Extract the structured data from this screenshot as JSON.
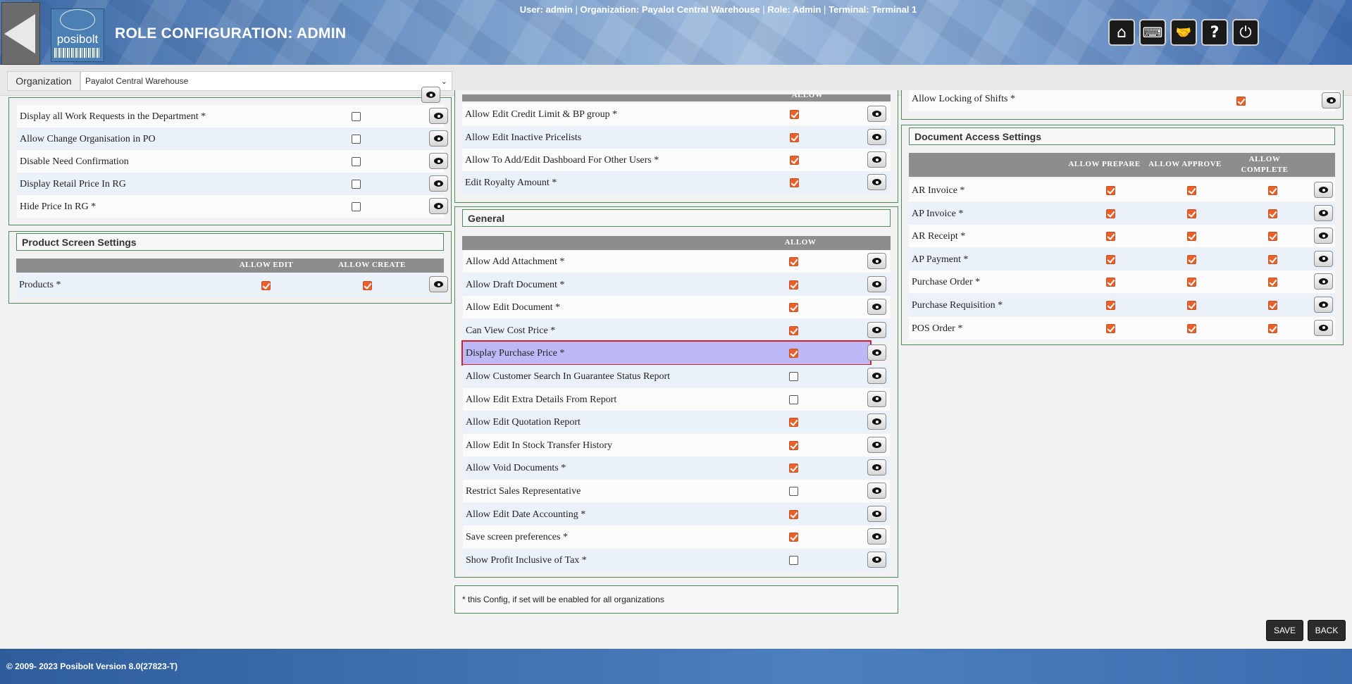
{
  "header": {
    "title": "ROLE CONFIGURATION: ADMIN",
    "logo_text": "posibolt",
    "user_label": "User: admin",
    "org_label": "Organization: Payalot Central Warehouse",
    "role_label": "Role: Admin",
    "terminal_label": "Terminal: Terminal 1",
    "separator": "|",
    "icons": [
      "home-icon",
      "keyboard-icon",
      "handshake-icon",
      "help-icon",
      "power-icon"
    ],
    "icon_glyphs": [
      "⌂",
      "⌨",
      "🤝",
      "?",
      "⏻"
    ]
  },
  "orgbar": {
    "label": "Organization",
    "selected": "Payalot Central Warehouse"
  },
  "left_top_rows": [
    {
      "label": "Display all Work Requests in the Department *",
      "checked": false
    },
    {
      "label": "Allow Change Organisation in PO",
      "checked": false
    },
    {
      "label": "Disable Need Confirmation",
      "checked": false
    },
    {
      "label": "Display Retail Price In RG",
      "checked": false
    },
    {
      "label": "Hide Price In RG *",
      "checked": false
    }
  ],
  "product_screen": {
    "title": "Product Screen Settings",
    "col_edit": "ALLOW EDIT",
    "col_create": "ALLOW CREATE",
    "rows": [
      {
        "label": "Products *",
        "edit": true,
        "create": true
      }
    ]
  },
  "mid_top": {
    "col_allow": "ALLOW",
    "rows": [
      {
        "label": "Allow Edit Credit Limit & BP group *",
        "checked": true
      },
      {
        "label": "Allow Edit Inactive Pricelists",
        "checked": true
      },
      {
        "label": "Allow To Add/Edit Dashboard For Other Users *",
        "checked": true
      },
      {
        "label": "Edit Royalty Amount *",
        "checked": true
      }
    ]
  },
  "general": {
    "title": "General",
    "col_allow": "ALLOW",
    "rows": [
      {
        "label": "Allow Add Attachment *",
        "checked": true
      },
      {
        "label": "Allow Draft Document *",
        "checked": true
      },
      {
        "label": "Allow Edit Document *",
        "checked": true
      },
      {
        "label": "Can View Cost Price *",
        "checked": true
      },
      {
        "label": "Display Purchase Price *",
        "checked": true
      },
      {
        "label": "Allow Customer Search In Guarantee Status Report",
        "checked": false
      },
      {
        "label": "Allow Edit Extra Details From Report",
        "checked": false
      },
      {
        "label": "Allow Edit Quotation Report",
        "checked": true
      },
      {
        "label": "Allow Edit In Stock Transfer History",
        "checked": true
      },
      {
        "label": "Allow Void Documents *",
        "checked": true
      },
      {
        "label": "Restrict Sales Representative",
        "checked": false
      },
      {
        "label": "Allow Edit Date Accounting *",
        "checked": true
      },
      {
        "label": "Save screen preferences *",
        "checked": true
      },
      {
        "label": "Show Profit Inclusive of Tax *",
        "checked": false
      }
    ]
  },
  "right_top": {
    "rows": [
      {
        "label": "Allow Locking of Shifts *",
        "checked": true
      }
    ]
  },
  "document_access": {
    "title": "Document Access Settings",
    "col_prepare": "ALLOW PREPARE",
    "col_approve": "ALLOW APPROVE",
    "col_complete_1": "ALLOW",
    "col_complete_2": "COMPLETE",
    "rows": [
      {
        "label": "AR Invoice *"
      },
      {
        "label": "AP Invoice *"
      },
      {
        "label": "AR Receipt *"
      },
      {
        "label": "AP Payment *"
      },
      {
        "label": "Purchase Order *"
      },
      {
        "label": "Purchase Requisition *"
      },
      {
        "label": "POS Order *"
      }
    ]
  },
  "note": "* this Config, if set will be enabled for all organizations",
  "buttons": {
    "save": "SAVE",
    "back": "BACK"
  },
  "footer": "© 2009- 2023 Posibolt Version  8.0(27823-T)"
}
